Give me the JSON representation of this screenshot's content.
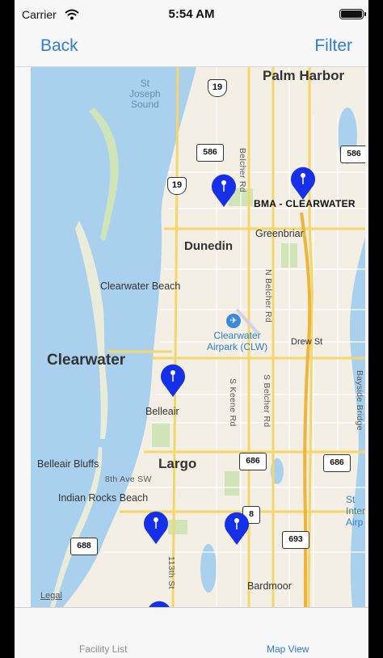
{
  "status_bar": {
    "carrier": "Carrier",
    "time": "5:54 AM"
  },
  "nav": {
    "back_label": "Back",
    "filter_label": "Filter"
  },
  "map": {
    "places": {
      "palm_harbor": "Palm Harbor",
      "st_joseph_sound": "St\nJoseph\nSound",
      "dunedin": "Dunedin",
      "greenbriar": "Greenbriar",
      "clearwater_beach": "Clearwater Beach",
      "clearwater": "Clearwater",
      "airport": "Clearwater\nAirpark (CLW)",
      "drew_st": "Drew St",
      "belleair": "Belleair",
      "belleair_bluffs": "Belleair Bluffs",
      "largo": "Largo",
      "eighth_ave": "8th Ave SW",
      "indian_rocks_beach": "Indian Rocks Beach",
      "bardmoor": "Bardmoor",
      "belcher_rd": "Belcher Rd",
      "n_belcher_rd": "N Belcher Rd",
      "s_belcher_rd": "S Belcher Rd",
      "s_keene_rd": "S Keene Rd",
      "bayside_bridge": "Bayside Bridge",
      "st_intl_airport": "St\nInter\nAirp",
      "street_113th": "113th St"
    },
    "shields": {
      "us19_top": "19",
      "us19_mid": "19",
      "fl586_left": "586",
      "fl586_right": "586",
      "fl686_mid": "686",
      "fl686_right": "686",
      "fl688": "688",
      "fl693": "693",
      "fl_partial": "8"
    },
    "pin_callout": "BMA - CLEARWATER",
    "legal": "Legal",
    "pin_color": "#1530e8"
  },
  "tabs": {
    "facility_list": "Facility List",
    "map_view": "Map View",
    "active_color": "#2e7ed9"
  }
}
